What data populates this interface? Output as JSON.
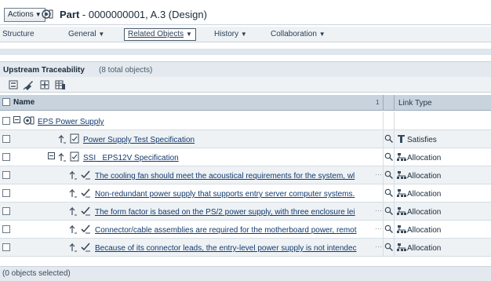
{
  "header": {
    "actions_label": "Actions",
    "title_bold": "Part",
    "title_rest": " - 0000000001, A.3 (Design)"
  },
  "menubar": {
    "items": [
      {
        "label": "Structure"
      },
      {
        "label": "General"
      },
      {
        "label": "Related Objects"
      },
      {
        "label": "History"
      },
      {
        "label": "Collaboration"
      }
    ]
  },
  "panel": {
    "title": "Upstream Traceability",
    "count": "(8 total objects)"
  },
  "table": {
    "col_name": "Name",
    "sort_indicator": "1",
    "col_link_type": "Link Type",
    "rows": [
      {
        "name": "EPS Power Supply",
        "link_type": "",
        "ellipsis": ""
      },
      {
        "name": "Power Supply Test Specification",
        "link_type": "Satisfies",
        "ellipsis": ""
      },
      {
        "name": "SSI _EPS12V Specification",
        "link_type": "Allocation",
        "ellipsis": ""
      },
      {
        "name": "The cooling fan should meet the acoustical requirements for the system, wl",
        "link_type": "Allocation",
        "ellipsis": "···"
      },
      {
        "name": "Non-redundant power supply that supports entry server computer systems.",
        "link_type": "Allocation",
        "ellipsis": ""
      },
      {
        "name": "The form factor is based on the PS/2 power supply, with three enclosure lei",
        "link_type": "Allocation",
        "ellipsis": "···"
      },
      {
        "name": "Connector/cable assemblies are required for the motherboard power, remot",
        "link_type": "Allocation",
        "ellipsis": "···"
      },
      {
        "name": "Because of its connector leads, the entry-level power supply is not intendec",
        "link_type": "Allocation",
        "ellipsis": "···"
      }
    ]
  },
  "status": {
    "text": "(0 objects selected)"
  },
  "colors": {
    "link": "#123a6e",
    "header_bg": "#c8d3dd",
    "panel_bg": "#e3e9ee"
  }
}
